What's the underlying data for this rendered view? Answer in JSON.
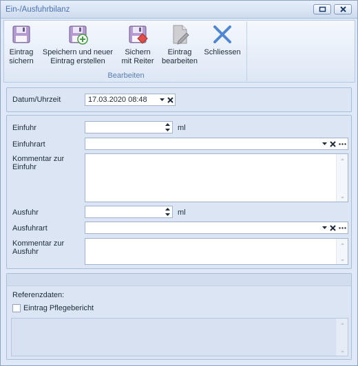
{
  "window": {
    "title": "Ein-/Ausfuhrbilanz",
    "controls": [
      "restore-icon",
      "close-icon"
    ]
  },
  "ribbon": {
    "group_label": "Bearbeiten",
    "buttons": {
      "save": {
        "line1": "Eintrag",
        "line2": "sichern",
        "icon": "floppy-disk-icon"
      },
      "save_new": {
        "line1": "Speichern und neuer",
        "line2": "Eintrag erstellen",
        "icon": "floppy-disk-add-icon"
      },
      "save_tab": {
        "line1": "Sichern",
        "line2": "mit Reiter",
        "icon": "floppy-disk-tab-icon"
      },
      "edit": {
        "line1": "Eintrag",
        "line2": "bearbeiten",
        "icon": "document-edit-icon"
      },
      "close": {
        "line1": "Schliessen",
        "icon": "close-x-icon"
      }
    }
  },
  "datetime": {
    "label": "Datum/Uhrzeit",
    "value": "17.03.2020 08:48"
  },
  "intake": {
    "label": "Einfuhr",
    "value": "",
    "unit": "ml",
    "type_label": "Einfuhrart",
    "type_value": "",
    "comment_label_1": "Kommentar zur",
    "comment_label_2": "Einfuhr",
    "comment_value": ""
  },
  "output": {
    "label": "Ausfuhr",
    "value": "",
    "unit": "ml",
    "type_label": "Ausfuhrart",
    "type_value": "",
    "comment_label_1": "Kommentar zur",
    "comment_label_2": "Ausfuhr",
    "comment_value": ""
  },
  "reference": {
    "label": "Referenzdaten:",
    "checkbox_label": "Eintrag Pflegebericht",
    "checkbox_checked": false,
    "text": ""
  }
}
